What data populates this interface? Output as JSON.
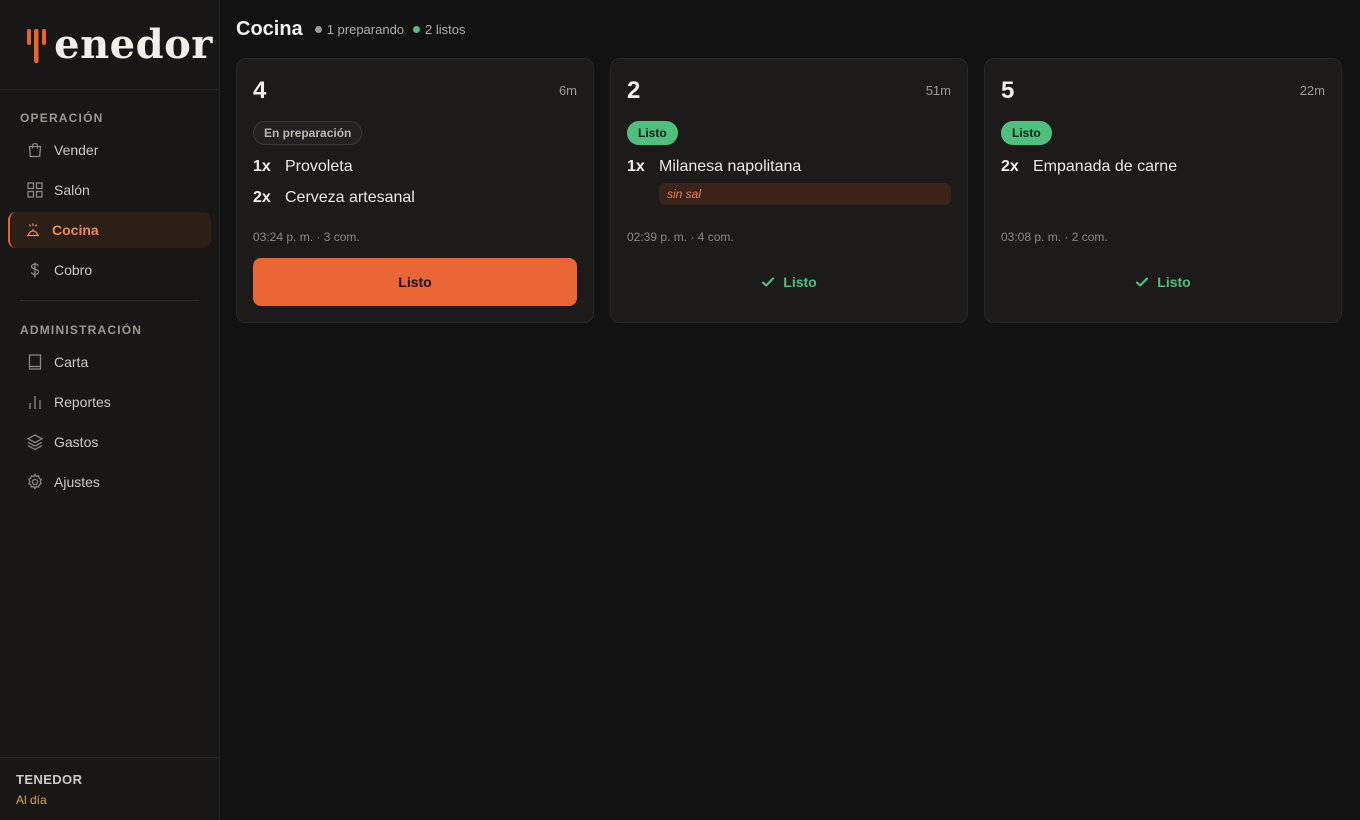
{
  "brand": {
    "logo_text": "enedor",
    "accent": "#e8652f"
  },
  "sidebar": {
    "sections": [
      {
        "title": "OPERACIÓN",
        "items": [
          {
            "label": "Vender",
            "icon": "shopping-bag-icon",
            "active": false
          },
          {
            "label": "Salón",
            "icon": "grid-icon",
            "active": false
          },
          {
            "label": "Cocina",
            "icon": "chef-hat-icon",
            "active": true
          },
          {
            "label": "Cobro",
            "icon": "dollar-icon",
            "active": false
          }
        ]
      },
      {
        "title": "ADMINISTRACIÓN",
        "items": [
          {
            "label": "Carta",
            "icon": "book-icon",
            "active": false
          },
          {
            "label": "Reportes",
            "icon": "bar-chart-icon",
            "active": false
          },
          {
            "label": "Gastos",
            "icon": "layers-icon",
            "active": false
          },
          {
            "label": "Ajustes",
            "icon": "gear-icon",
            "active": false
          }
        ]
      }
    ],
    "footer": {
      "title": "TENEDOR",
      "status": "Al día",
      "status_color": "#e0a53c"
    }
  },
  "header": {
    "title": "Cocina",
    "summary": [
      {
        "text": "1 preparando",
        "dot_color": "#9e9890"
      },
      {
        "text": "2 listos",
        "dot_color": "#4fbf7d"
      }
    ]
  },
  "orders": [
    {
      "table": "4",
      "elapsed": "6m",
      "status": "En preparación",
      "status_type": "preparing",
      "items": [
        {
          "qty": "1x",
          "name": "Provoleta",
          "note": ""
        },
        {
          "qty": "2x",
          "name": "Cerveza artesanal",
          "note": ""
        }
      ],
      "meta": "03:24 p. m. · 3 com.",
      "action_label": "Listo",
      "action_type": "primary"
    },
    {
      "table": "2",
      "elapsed": "51m",
      "status": "Listo",
      "status_type": "ready",
      "items": [
        {
          "qty": "1x",
          "name": "Milanesa napolitana",
          "note": "sin sal"
        }
      ],
      "meta": "02:39 p. m. · 4 com.",
      "action_label": "Listo",
      "action_type": "done"
    },
    {
      "table": "5",
      "elapsed": "22m",
      "status": "Listo",
      "status_type": "ready",
      "items": [
        {
          "qty": "2x",
          "name": "Empanada de carne",
          "note": ""
        }
      ],
      "meta": "03:08 p. m. · 2 com.",
      "action_label": "Listo",
      "action_type": "done"
    }
  ],
  "colors": {
    "ready": "#4fbf7d",
    "primary_button": "#e96634",
    "note_text": "#f0824d"
  }
}
